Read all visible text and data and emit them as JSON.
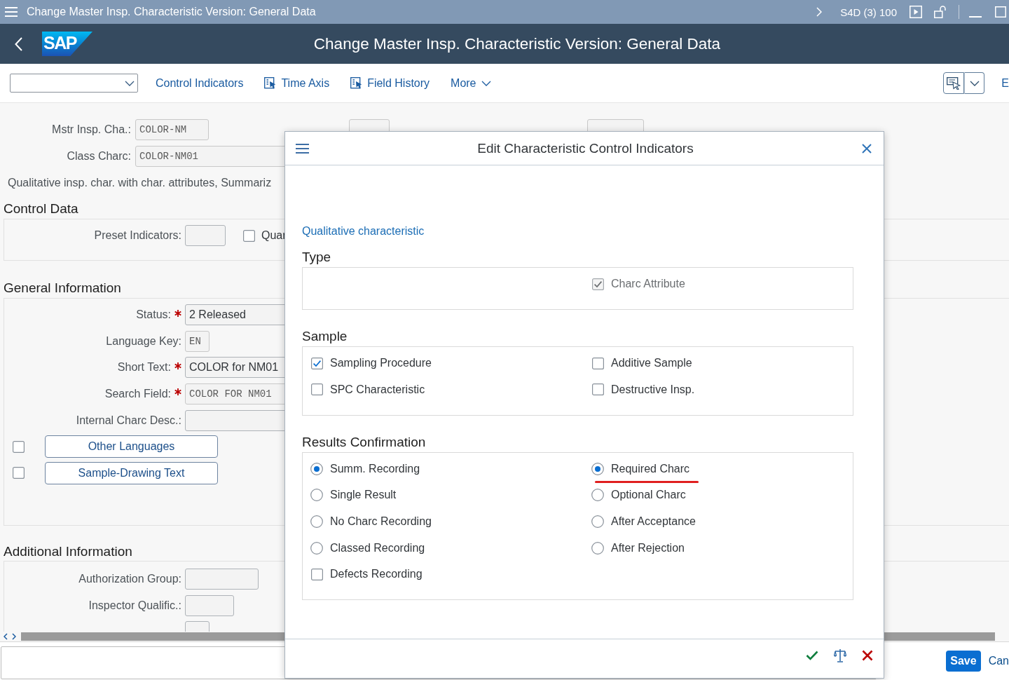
{
  "title_bar": {
    "title": "Change Master Insp. Characteristic Version: General Data",
    "system": "S4D (3) 100"
  },
  "shell_bar": {
    "logo": "SAP",
    "title": "Change Master Insp. Characteristic Version: General Data"
  },
  "toolbar": {
    "items": [
      {
        "kind": "link",
        "label": "Control Indicators"
      },
      {
        "kind": "icon-link",
        "label": "Time Axis"
      },
      {
        "kind": "icon-link",
        "label": "Field History"
      },
      {
        "kind": "menu",
        "label": "More"
      }
    ],
    "overflow": "E"
  },
  "header_rows": [
    {
      "fields": [
        {
          "label": "Mstr Insp. Cha.:",
          "value": "COLOR-NM",
          "required": false,
          "readonly": true
        },
        {
          "readonly": true
        },
        {
          "readonly": true
        }
      ]
    },
    {
      "fields": [
        {
          "label": "Class Charc:",
          "value": "COLOR-NM01",
          "required": false,
          "readonly": true
        }
      ]
    }
  ],
  "description": "Qualitative insp. char. with char. attributes, Summariz",
  "sections": [
    {
      "title": "Control Data",
      "rows": [
        {
          "items": [
            {
              "kind": "field",
              "label": "Preset Indicators:",
              "required": false,
              "readonly": false
            },
            {
              "kind": "checkbox",
              "label": "Quar",
              "checked": false
            }
          ]
        }
      ]
    },
    {
      "title": "General Information",
      "rows": [
        {
          "items": [
            {
              "kind": "field",
              "label": "Status:",
              "value": "2 Released",
              "required": true,
              "readonly": false
            }
          ]
        },
        {
          "items": [
            {
              "kind": "field",
              "label": "Language Key:",
              "value": "EN",
              "required": false,
              "readonly": true
            }
          ]
        },
        {
          "items": [
            {
              "kind": "field",
              "label": "Short Text:",
              "value": "COLOR for NM01",
              "required": true,
              "readonly": false
            }
          ]
        },
        {
          "items": [
            {
              "kind": "field",
              "label": "Search Field:",
              "value": "COLOR FOR NM01",
              "required": true,
              "readonly": true
            }
          ]
        },
        {
          "items": [
            {
              "kind": "field",
              "label": "Internal Charc Desc.:",
              "required": false,
              "readonly": false
            }
          ]
        },
        {
          "items": [
            {
              "kind": "checkbox",
              "checked": false
            },
            {
              "kind": "button",
              "label": "Other Languages"
            }
          ]
        },
        {
          "items": [
            {
              "kind": "checkbox",
              "checked": false
            },
            {
              "kind": "button",
              "label": "Sample-Drawing Text"
            }
          ]
        }
      ]
    },
    {
      "title": "Additional Information",
      "rows": [
        {
          "items": [
            {
              "kind": "field",
              "label": "Authorization Group:",
              "required": false,
              "readonly": false
            }
          ]
        },
        {
          "items": [
            {
              "kind": "field",
              "label": "Inspector Qualific.:",
              "required": false,
              "readonly": false
            }
          ]
        },
        {
          "items": [
            {
              "kind": "field",
              "readonly": false
            }
          ]
        }
      ]
    }
  ],
  "dialog": {
    "title": "Edit Characteristic Control Indicators",
    "subtitle": "Qualitative characteristic",
    "groups": [
      {
        "title": "Type",
        "right": [
          {
            "kind": "checkbox",
            "label": "Charc Attribute",
            "checked": true,
            "disabled": true
          }
        ]
      },
      {
        "title": "Sample",
        "left": [
          {
            "kind": "checkbox",
            "label": "Sampling Procedure",
            "checked": true,
            "disabled": false
          },
          {
            "kind": "checkbox",
            "label": "SPC Characteristic",
            "checked": false,
            "disabled": false
          }
        ],
        "right": [
          {
            "kind": "checkbox",
            "label": "Additive Sample",
            "checked": false,
            "disabled": false
          },
          {
            "kind": "checkbox",
            "label": "Destructive Insp.",
            "checked": false,
            "disabled": false
          }
        ]
      },
      {
        "title": "Results Confirmation",
        "left": [
          {
            "kind": "radio",
            "label": "Summ. Recording",
            "selected": true
          },
          {
            "kind": "radio",
            "label": "Single Result",
            "selected": false
          },
          {
            "kind": "radio",
            "label": "No Charc Recording",
            "selected": false
          },
          {
            "kind": "radio",
            "label": "Classed Recording",
            "selected": false
          },
          {
            "kind": "checkbox",
            "label": "Defects Recording",
            "checked": false,
            "disabled": false
          }
        ],
        "right": [
          {
            "kind": "radio",
            "label": "Required Charc",
            "selected": true,
            "underlined": true
          },
          {
            "kind": "radio",
            "label": "Optional Charc",
            "selected": false,
            "underlined": false
          },
          {
            "kind": "radio",
            "label": "After Acceptance",
            "selected": false,
            "underlined": false
          },
          {
            "kind": "radio",
            "label": "After Rejection",
            "selected": false,
            "underlined": false
          }
        ]
      }
    ]
  },
  "footer": {
    "buttons": [
      {
        "kind": "primary",
        "label": "Save"
      },
      {
        "kind": "text",
        "label": "Can"
      }
    ]
  }
}
